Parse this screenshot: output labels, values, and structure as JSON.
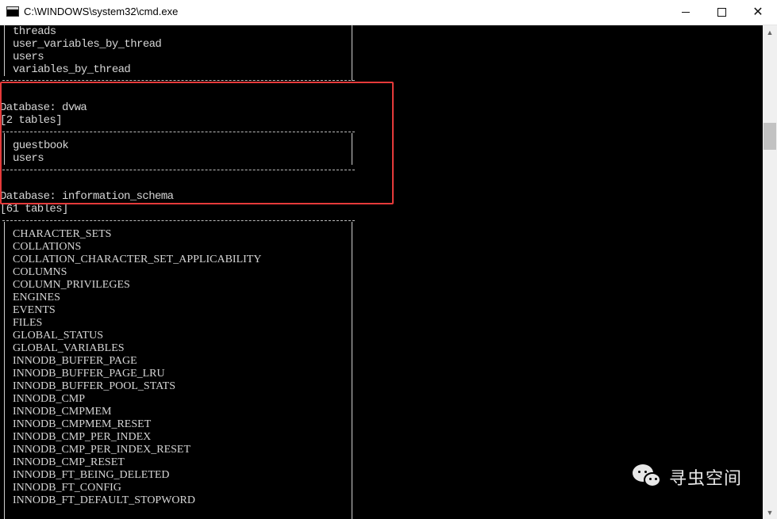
{
  "window": {
    "title": "C:\\WINDOWS\\system32\\cmd.exe",
    "icon": "console-app-icon",
    "controls": {
      "minimize_icon": "minimize-icon",
      "maximize_icon": "maximize-icon",
      "close_icon": "close-icon"
    }
  },
  "console": {
    "top_tables": [
      "threads",
      "user_variables_by_thread",
      "users",
      "variables_by_thread"
    ],
    "dvwa": {
      "database_line": "Database: dvwa",
      "count_line": "[2 tables]",
      "tables": [
        "guestbook",
        "users"
      ]
    },
    "information_schema": {
      "database_line": "Database: information_schema",
      "count_line": "[61 tables]",
      "tables": [
        "CHARACTER_SETS",
        "COLLATIONS",
        "COLLATION_CHARACTER_SET_APPLICABILITY",
        "COLUMNS",
        "COLUMN_PRIVILEGES",
        "ENGINES",
        "EVENTS",
        "FILES",
        "GLOBAL_STATUS",
        "GLOBAL_VARIABLES",
        "INNODB_BUFFER_PAGE",
        "INNODB_BUFFER_PAGE_LRU",
        "INNODB_BUFFER_POOL_STATS",
        "INNODB_CMP",
        "INNODB_CMPMEM",
        "INNODB_CMPMEM_RESET",
        "INNODB_CMP_PER_INDEX",
        "INNODB_CMP_PER_INDEX_RESET",
        "INNODB_CMP_RESET",
        "INNODB_FT_BEING_DELETED",
        "INNODB_FT_CONFIG",
        "INNODB_FT_DEFAULT_STOPWORD"
      ]
    },
    "highlight_color": "#e53a3a",
    "text_color": "#d6d6d6",
    "background_color": "#000000"
  },
  "watermark": {
    "icon": "wechat-icon",
    "text": "寻虫空间"
  }
}
